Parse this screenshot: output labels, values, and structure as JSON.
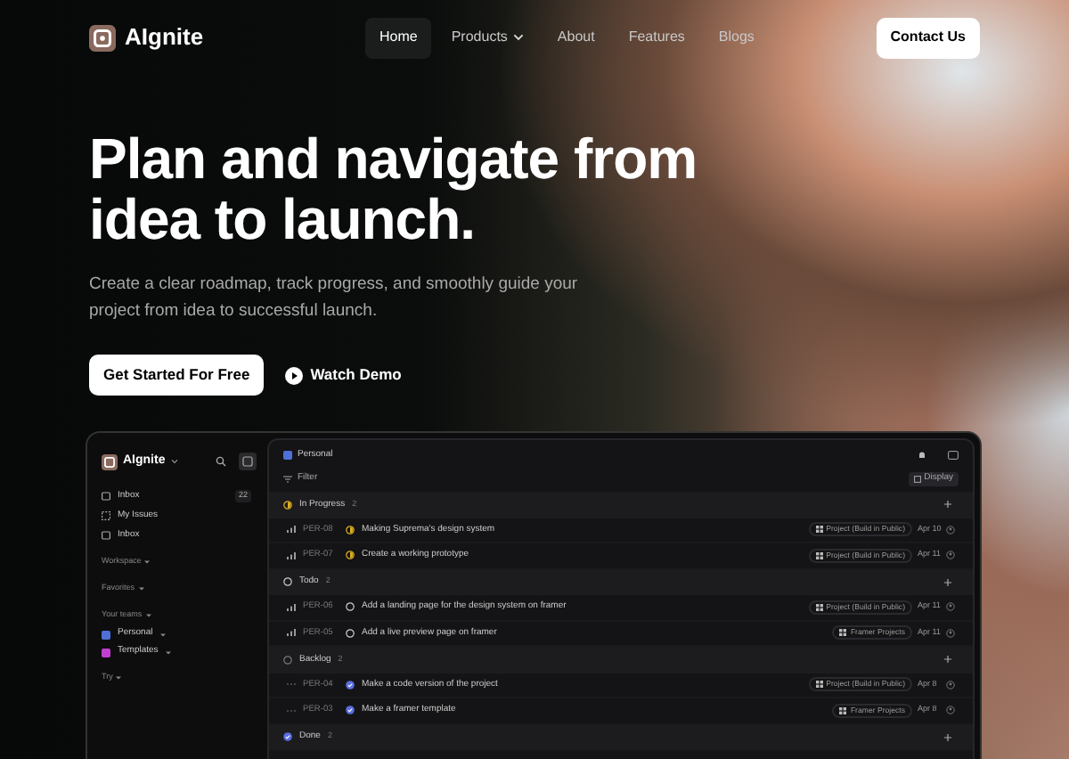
{
  "nav": {
    "brand": "AIgnite",
    "links": [
      {
        "label": "Home",
        "selected": true,
        "dropdown": false
      },
      {
        "label": "Products",
        "selected": false,
        "dropdown": true
      },
      {
        "label": "About",
        "selected": false,
        "dropdown": false
      },
      {
        "label": "Features",
        "selected": false,
        "dropdown": false
      },
      {
        "label": "Blogs",
        "selected": false,
        "dropdown": false
      }
    ],
    "cta": "Contact Us"
  },
  "hero": {
    "title_lines": [
      "Plan and navigate from",
      "idea to launch."
    ],
    "subtitle": "Create a clear roadmap, track progress, and smoothly guide your project from idea to successful launch.",
    "primary_button": "Get Started For Free",
    "secondary_button": "Watch Demo"
  },
  "app": {
    "sidebar": {
      "brand": "AIgnite",
      "items": [
        {
          "kind": "inbox",
          "label": "Inbox",
          "badge": "22"
        },
        {
          "kind": "issues",
          "label": "My Issues"
        },
        {
          "kind": "inbox",
          "label": "Inbox"
        },
        {
          "kind": "section",
          "label": "Workspace"
        },
        {
          "kind": "section",
          "label": "Favorites"
        },
        {
          "kind": "section",
          "label": "Your teams"
        },
        {
          "kind": "team",
          "label": "Personal",
          "color": "#4f6fd8"
        },
        {
          "kind": "team",
          "label": "Templates",
          "color": "#c03fd0"
        },
        {
          "kind": "section",
          "label": "Try"
        }
      ]
    },
    "main": {
      "title": "Personal",
      "filter": "Filter",
      "display": "Display",
      "groups": [
        {
          "kind": "progress",
          "label": "In Progress",
          "count": "2",
          "issues": [
            {
              "prioritized": true,
              "id": "PER-08",
              "kind": "progress",
              "title": "Making Suprema's design system",
              "project": "Project (Build in Public)",
              "date": "Apr 10"
            },
            {
              "prioritized": true,
              "id": "PER-07",
              "kind": "progress",
              "title": "Create a working prototype",
              "project": "Project (Build in Public)",
              "date": "Apr 11"
            }
          ]
        },
        {
          "kind": "todo",
          "label": "Todo",
          "count": "2",
          "issues": [
            {
              "prioritized": true,
              "id": "PER-06",
              "kind": "todo",
              "title": "Add a landing page for the design system on framer",
              "project": "Project (Build in Public)",
              "date": "Apr 11"
            },
            {
              "prioritized": true,
              "id": "PER-05",
              "kind": "todo",
              "title": "Add a live preview page on framer",
              "project": "Framer Projects",
              "date": "Apr 11"
            }
          ]
        },
        {
          "kind": "backlog",
          "label": "Backlog",
          "count": "2",
          "issues": [
            {
              "prioritized": false,
              "id": "PER-04",
              "kind": "done",
              "title": "Make a code version of the project",
              "project": "Project (Build in Public)",
              "date": "Apr 8"
            },
            {
              "prioritized": false,
              "id": "PER-03",
              "kind": "done",
              "title": "Make a framer template",
              "project": "Framer Projects",
              "date": "Apr 8"
            }
          ]
        },
        {
          "kind": "done",
          "label": "Done",
          "count": "2"
        }
      ]
    }
  }
}
